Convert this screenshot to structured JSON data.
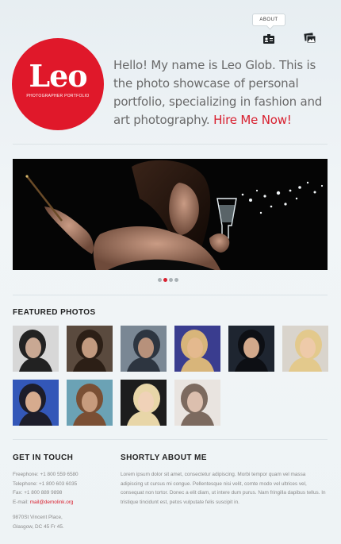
{
  "nav": {
    "about_label": "ABOUT"
  },
  "logo": {
    "word": "Leo",
    "subtitle": "PHOTOGRAPHER PORTFOLIO"
  },
  "intro": {
    "text": "Hello! My name is Leo Glob. This is the photo showcase of personal portfolio, specializing in fashion and art photography.",
    "cta": "Hire Me Now!"
  },
  "slider": {
    "dot_count": 4,
    "active_index": 1
  },
  "featured": {
    "title": "FEATURED PHOTOS",
    "thumbs": [
      {
        "name": "thumb-1",
        "bg": "#d7d7d7",
        "fg": "#222222",
        "skin": "#c9a893"
      },
      {
        "name": "thumb-2",
        "bg": "#5a4a3e",
        "fg": "#2c1f16",
        "skin": "#c29a7f"
      },
      {
        "name": "thumb-3",
        "bg": "#7a8794",
        "fg": "#2d3540",
        "skin": "#b7917b"
      },
      {
        "name": "thumb-4",
        "bg": "#3a3d8f",
        "fg": "#d8b57a",
        "skin": "#e4b98e"
      },
      {
        "name": "thumb-5",
        "bg": "#1e2530",
        "fg": "#0d0f14",
        "skin": "#d2a98c"
      },
      {
        "name": "thumb-6",
        "bg": "#d9d4cc",
        "fg": "#e3c98c",
        "skin": "#eecaa9"
      },
      {
        "name": "thumb-7",
        "bg": "#3357b8",
        "fg": "#1d1d2a",
        "skin": "#d6ab8e"
      },
      {
        "name": "thumb-8",
        "bg": "#6ba2b5",
        "fg": "#7a4f34",
        "skin": "#c79b7d"
      },
      {
        "name": "thumb-9",
        "bg": "#1d1d1d",
        "fg": "#e8d6a8",
        "skin": "#f0d2b8"
      },
      {
        "name": "thumb-10",
        "bg": "#e9e4e0",
        "fg": "#7c6a5f",
        "skin": "#dcbfae"
      }
    ]
  },
  "contact": {
    "title": "GET IN TOUCH",
    "freephone": "Freephone: +1 800 559 6580",
    "telephone": "Telephone: +1 800 603 6035",
    "fax": "Fax: +1 800 889 9898",
    "email_label": "E-mail: ",
    "email": "mail@demolink.org",
    "address_line1": "9870St Vincent Place,",
    "address_line2": "Glasgow, DC 45 Fr 45."
  },
  "about": {
    "title": "SHORTLY ABOUT ME",
    "text": "Lorem ipsum dolor sit amet, consectetur adipiscing. Morbi tempor quam vel massa adipiscing ut cursus mi congue. Pellentesque nisi velit, comte modo vel ultrices vel, consequat non tortor. Donec a elit diam, ut intere dum purus. Nam fringilla dapibus tellus. In tristique tincidunt est, petos vulputate felis suscipit in."
  },
  "colors": {
    "accent": "#d8202f",
    "logo_bg": "#e0182a",
    "text": "#6a6a6a"
  }
}
